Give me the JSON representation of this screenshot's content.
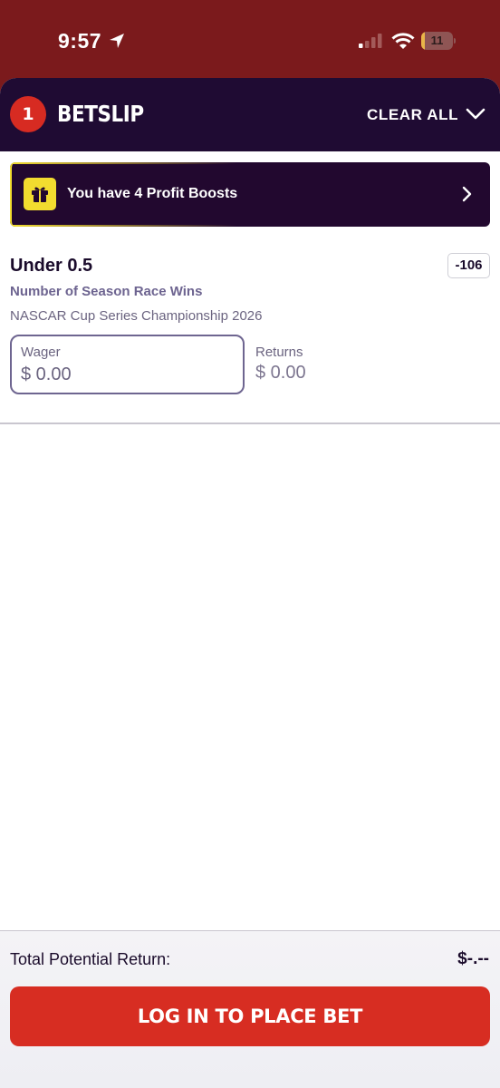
{
  "status_bar": {
    "time": "9:57",
    "battery": "11",
    "battery_level": 0.11
  },
  "header": {
    "count": "1",
    "title": "BETSLIP",
    "clear_all": "CLEAR ALL"
  },
  "promo": {
    "text": "You have 4 Profit Boosts"
  },
  "selection": {
    "title": "Under 0.5",
    "odds": "-106",
    "market": "Number of Season Race Wins",
    "event": "NASCAR Cup Series Championship 2026",
    "wager_label": "Wager",
    "wager_placeholder": "$ 0.00",
    "returns_label": "Returns",
    "returns_value": "$ 0.00"
  },
  "footer": {
    "total_label": "Total Potential Return:",
    "total_value": "$-.--",
    "button_label": "LOG IN TO PLACE BET"
  },
  "colors": {
    "status_bg": "#7b1a1c",
    "header_bg": "#1f0b33",
    "accent_red": "#d72d22",
    "promo_yellow": "#f2dc2f"
  }
}
